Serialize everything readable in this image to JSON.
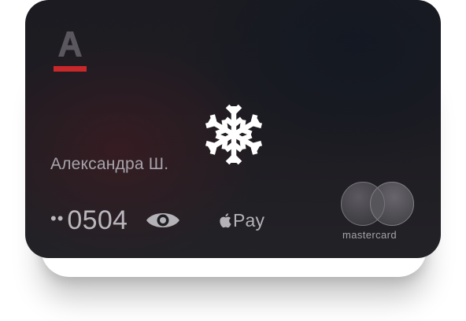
{
  "card": {
    "holder_name": "Александра Ш.",
    "number_mask": "••",
    "last_digits": "0504",
    "pay_label": "Pay",
    "network_label": "mastercard",
    "status": "frozen"
  },
  "icons": {
    "bank_logo": "alfa-bank-logo",
    "status": "snowflake-icon",
    "reveal": "eye-icon",
    "wallet": "apple-icon",
    "network": "mastercard-logo"
  },
  "colors": {
    "card_background": "#1e1d22",
    "logo_red": "#c8282a",
    "text_primary": "#b9b7bc",
    "snowflake": "#ffffff"
  }
}
